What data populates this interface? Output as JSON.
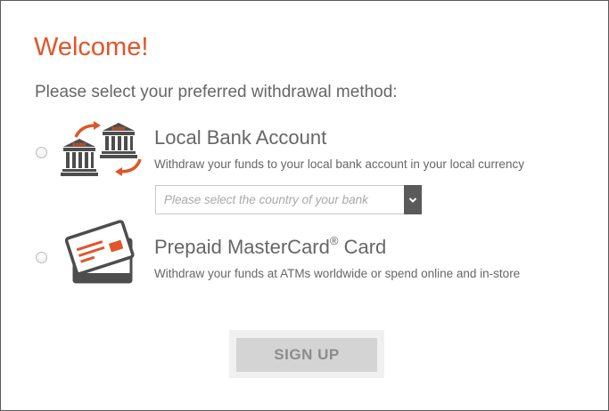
{
  "header": {
    "title": "Welcome!",
    "subtitle": "Please select your preferred withdrawal method:"
  },
  "options": [
    {
      "id": "local-bank",
      "title": "Local Bank Account",
      "description": "Withdraw your funds to your local bank account in your local currency",
      "icon": "bank-transfer-icon",
      "icon_text": [
        "BANK",
        "BANK"
      ],
      "selected": false,
      "country_select": {
        "placeholder": "Please select the country of your bank",
        "value": ""
      }
    },
    {
      "id": "prepaid-card",
      "title": "Prepaid MasterCard",
      "title_mark": "®",
      "title_suffix": " Card",
      "description": "Withdraw your funds at ATMs worldwide or spend online and in-store",
      "icon": "prepaid-card-icon",
      "selected": false
    }
  ],
  "actions": {
    "signup_label": "SIGN UP",
    "signup_enabled": false
  },
  "colors": {
    "accent": "#e0552a",
    "text": "#666666",
    "icon_dark": "#4d4d4d",
    "button_bg": "#d4d4d4"
  }
}
